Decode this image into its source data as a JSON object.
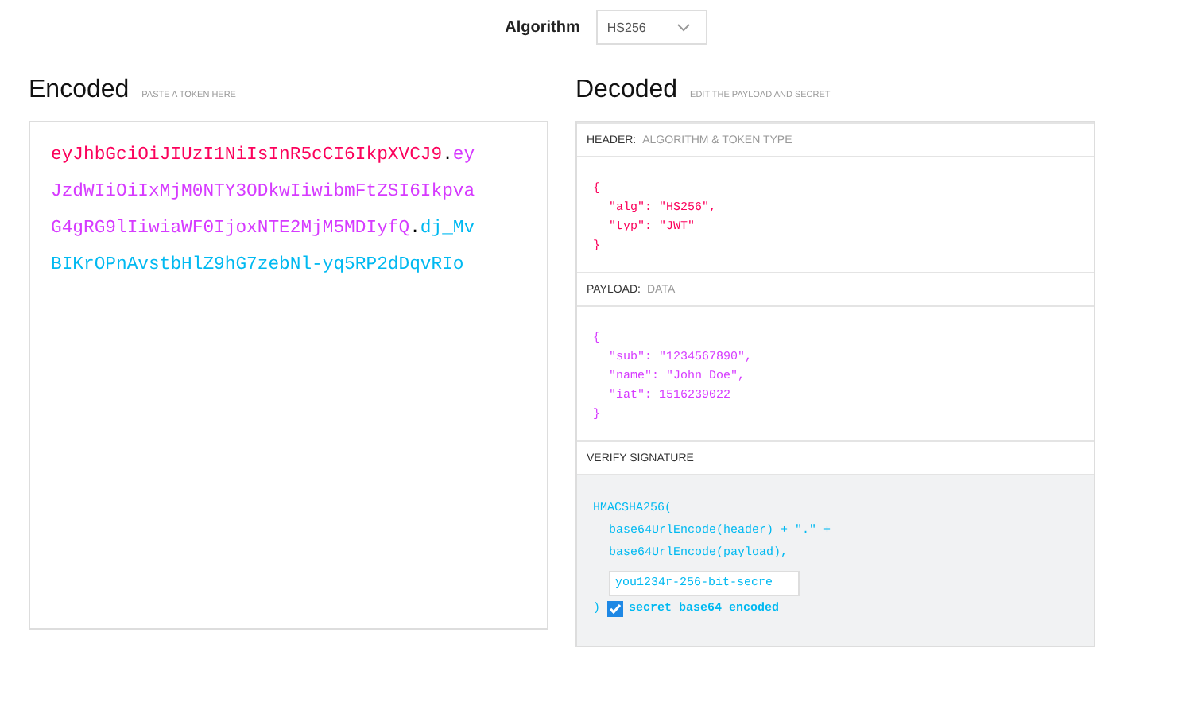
{
  "algorithm": {
    "label": "Algorithm",
    "value": "HS256"
  },
  "encoded": {
    "title": "Encoded",
    "hint": "PASTE A TOKEN HERE",
    "lines": [
      [
        {
          "text": "eyJhbGciOiJIUzI1NiIsInR5cCI6IkpXVCJ9",
          "kind": "header"
        },
        {
          "text": ".",
          "kind": "dot"
        },
        {
          "text": "ey",
          "kind": "payload"
        }
      ],
      [
        {
          "text": "JzdWIiOiIxMjM0NTY3ODkwIiwibmFtZSI6Ikpva",
          "kind": "payload"
        }
      ],
      [
        {
          "text": "G4gRG9lIiwiaWF0IjoxNTE2MjM5MDIyfQ",
          "kind": "payload"
        },
        {
          "text": ".",
          "kind": "dot"
        },
        {
          "text": "dj_Mv",
          "kind": "signature"
        }
      ],
      [
        {
          "text": "BIKrOPnAvstbHlZ9hG7zebNl-yq5RP2dDqvRIo",
          "kind": "signature"
        }
      ]
    ]
  },
  "decoded": {
    "title": "Decoded",
    "hint": "EDIT THE PAYLOAD AND SECRET",
    "header": {
      "label": "HEADER:",
      "sublabel": "ALGORITHM & TOKEN TYPE",
      "lines": [
        {
          "text": "{",
          "indented": false
        },
        {
          "text": "\"alg\": \"HS256\",",
          "indented": true
        },
        {
          "text": "\"typ\": \"JWT\"",
          "indented": true
        },
        {
          "text": "}",
          "indented": false
        }
      ]
    },
    "payload": {
      "label": "PAYLOAD:",
      "sublabel": "DATA",
      "lines": [
        {
          "text": "{",
          "indented": false
        },
        {
          "text": "\"sub\": \"1234567890\",",
          "indented": true
        },
        {
          "text": "\"name\": \"John Doe\",",
          "indented": true
        },
        {
          "text": "\"iat\": 1516239022",
          "indented": true
        },
        {
          "text": "}",
          "indented": false
        }
      ]
    },
    "signature": {
      "label": "VERIFY SIGNATURE",
      "open": "HMACSHA256(",
      "lines": [
        "base64UrlEncode(header) + \".\" +",
        "base64UrlEncode(payload),"
      ],
      "secret": "you1234r-256-bit-secre",
      "close": ")",
      "base64": {
        "label": "secret base64 encoded",
        "checked": true
      }
    }
  }
}
